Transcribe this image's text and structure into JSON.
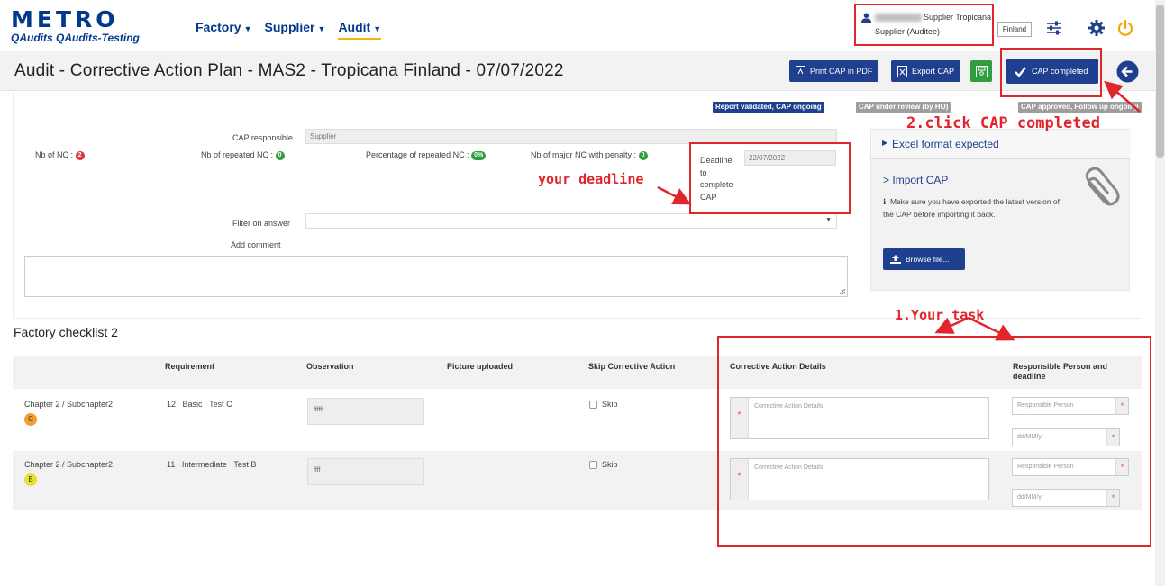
{
  "header": {
    "logo_main": "METRO",
    "logo_sub": "QAudits QAudits-Testing",
    "nav": [
      "Factory",
      "Supplier",
      "Audit"
    ],
    "user_name": "Supplier Tropicana",
    "user_role": "Supplier (Auditee)",
    "country": "Finland"
  },
  "page": {
    "title": "Audit - Corrective Action Plan  -  MAS2 - Tropicana Finland  -  07/07/2022",
    "print_btn": "Print CAP in PDF",
    "export_btn": "Export CAP",
    "cap_completed_btn": "CAP completed"
  },
  "status": {
    "badges": [
      "Report validated, CAP ongoing",
      "CAP under review (by HO)",
      "CAP approved, Follow up ongoing"
    ],
    "colors": [
      "#1f3f8f",
      "#9e9e9e",
      "#9e9e9e"
    ]
  },
  "form": {
    "cap_responsible_label": "CAP responsible",
    "cap_responsible_value": "Supplier",
    "nb_nc_label": "Nb of NC :",
    "nb_nc_value": "2",
    "nb_repeated_label": "Nb of repeated NC :",
    "nb_repeated_value": "0",
    "pct_repeated_label": "Percentage of repeated NC :",
    "pct_repeated_value": "0%",
    "nb_major_label": "Nb of major NC with penalty :",
    "nb_major_value": "0",
    "deadline_label_1": "Deadline",
    "deadline_label_2": "to",
    "deadline_label_3": "complete",
    "deadline_label_4": "CAP",
    "deadline_value": "22/07/2022",
    "filter_label": "Filter on answer",
    "filter_value": "-",
    "add_comment_label": "Add comment"
  },
  "right_panel": {
    "excel_label": "Excel format expected",
    "import_label": "Import CAP",
    "import_note": "Make sure you have exported the latest version of the CAP before importing it back.",
    "browse_btn": "Browse file..."
  },
  "checklist": {
    "title": "Factory checklist 2",
    "headers": [
      "Requirement",
      "Observation",
      "Picture uploaded",
      "Skip Corrective Action",
      "Corrective Action Details",
      "Responsible Person and deadline"
    ],
    "skip_label": "Skip",
    "cad_placeholder": "Corrective Action Details",
    "resp_placeholder": "Responsible Person",
    "date_placeholder": "dd/MM/y",
    "rows": [
      {
        "chapter": "Chapter 2 / Subchapter2",
        "grade": "C",
        "grade_color": "#f0a030",
        "req_num": "12",
        "req_level": "Basic",
        "req_name": "Test C",
        "observation": "ffffff"
      },
      {
        "chapter": "Chapter 2 / Subchapter2",
        "grade": "B",
        "grade_color": "#e8e030",
        "req_num": "11",
        "req_level": "Intermediate",
        "req_name": "Test B",
        "observation": "ffff"
      }
    ]
  },
  "annotations": {
    "click_cap": "2.click CAP completed",
    "your_deadline": "your deadline",
    "your_task": "1.Your task"
  }
}
